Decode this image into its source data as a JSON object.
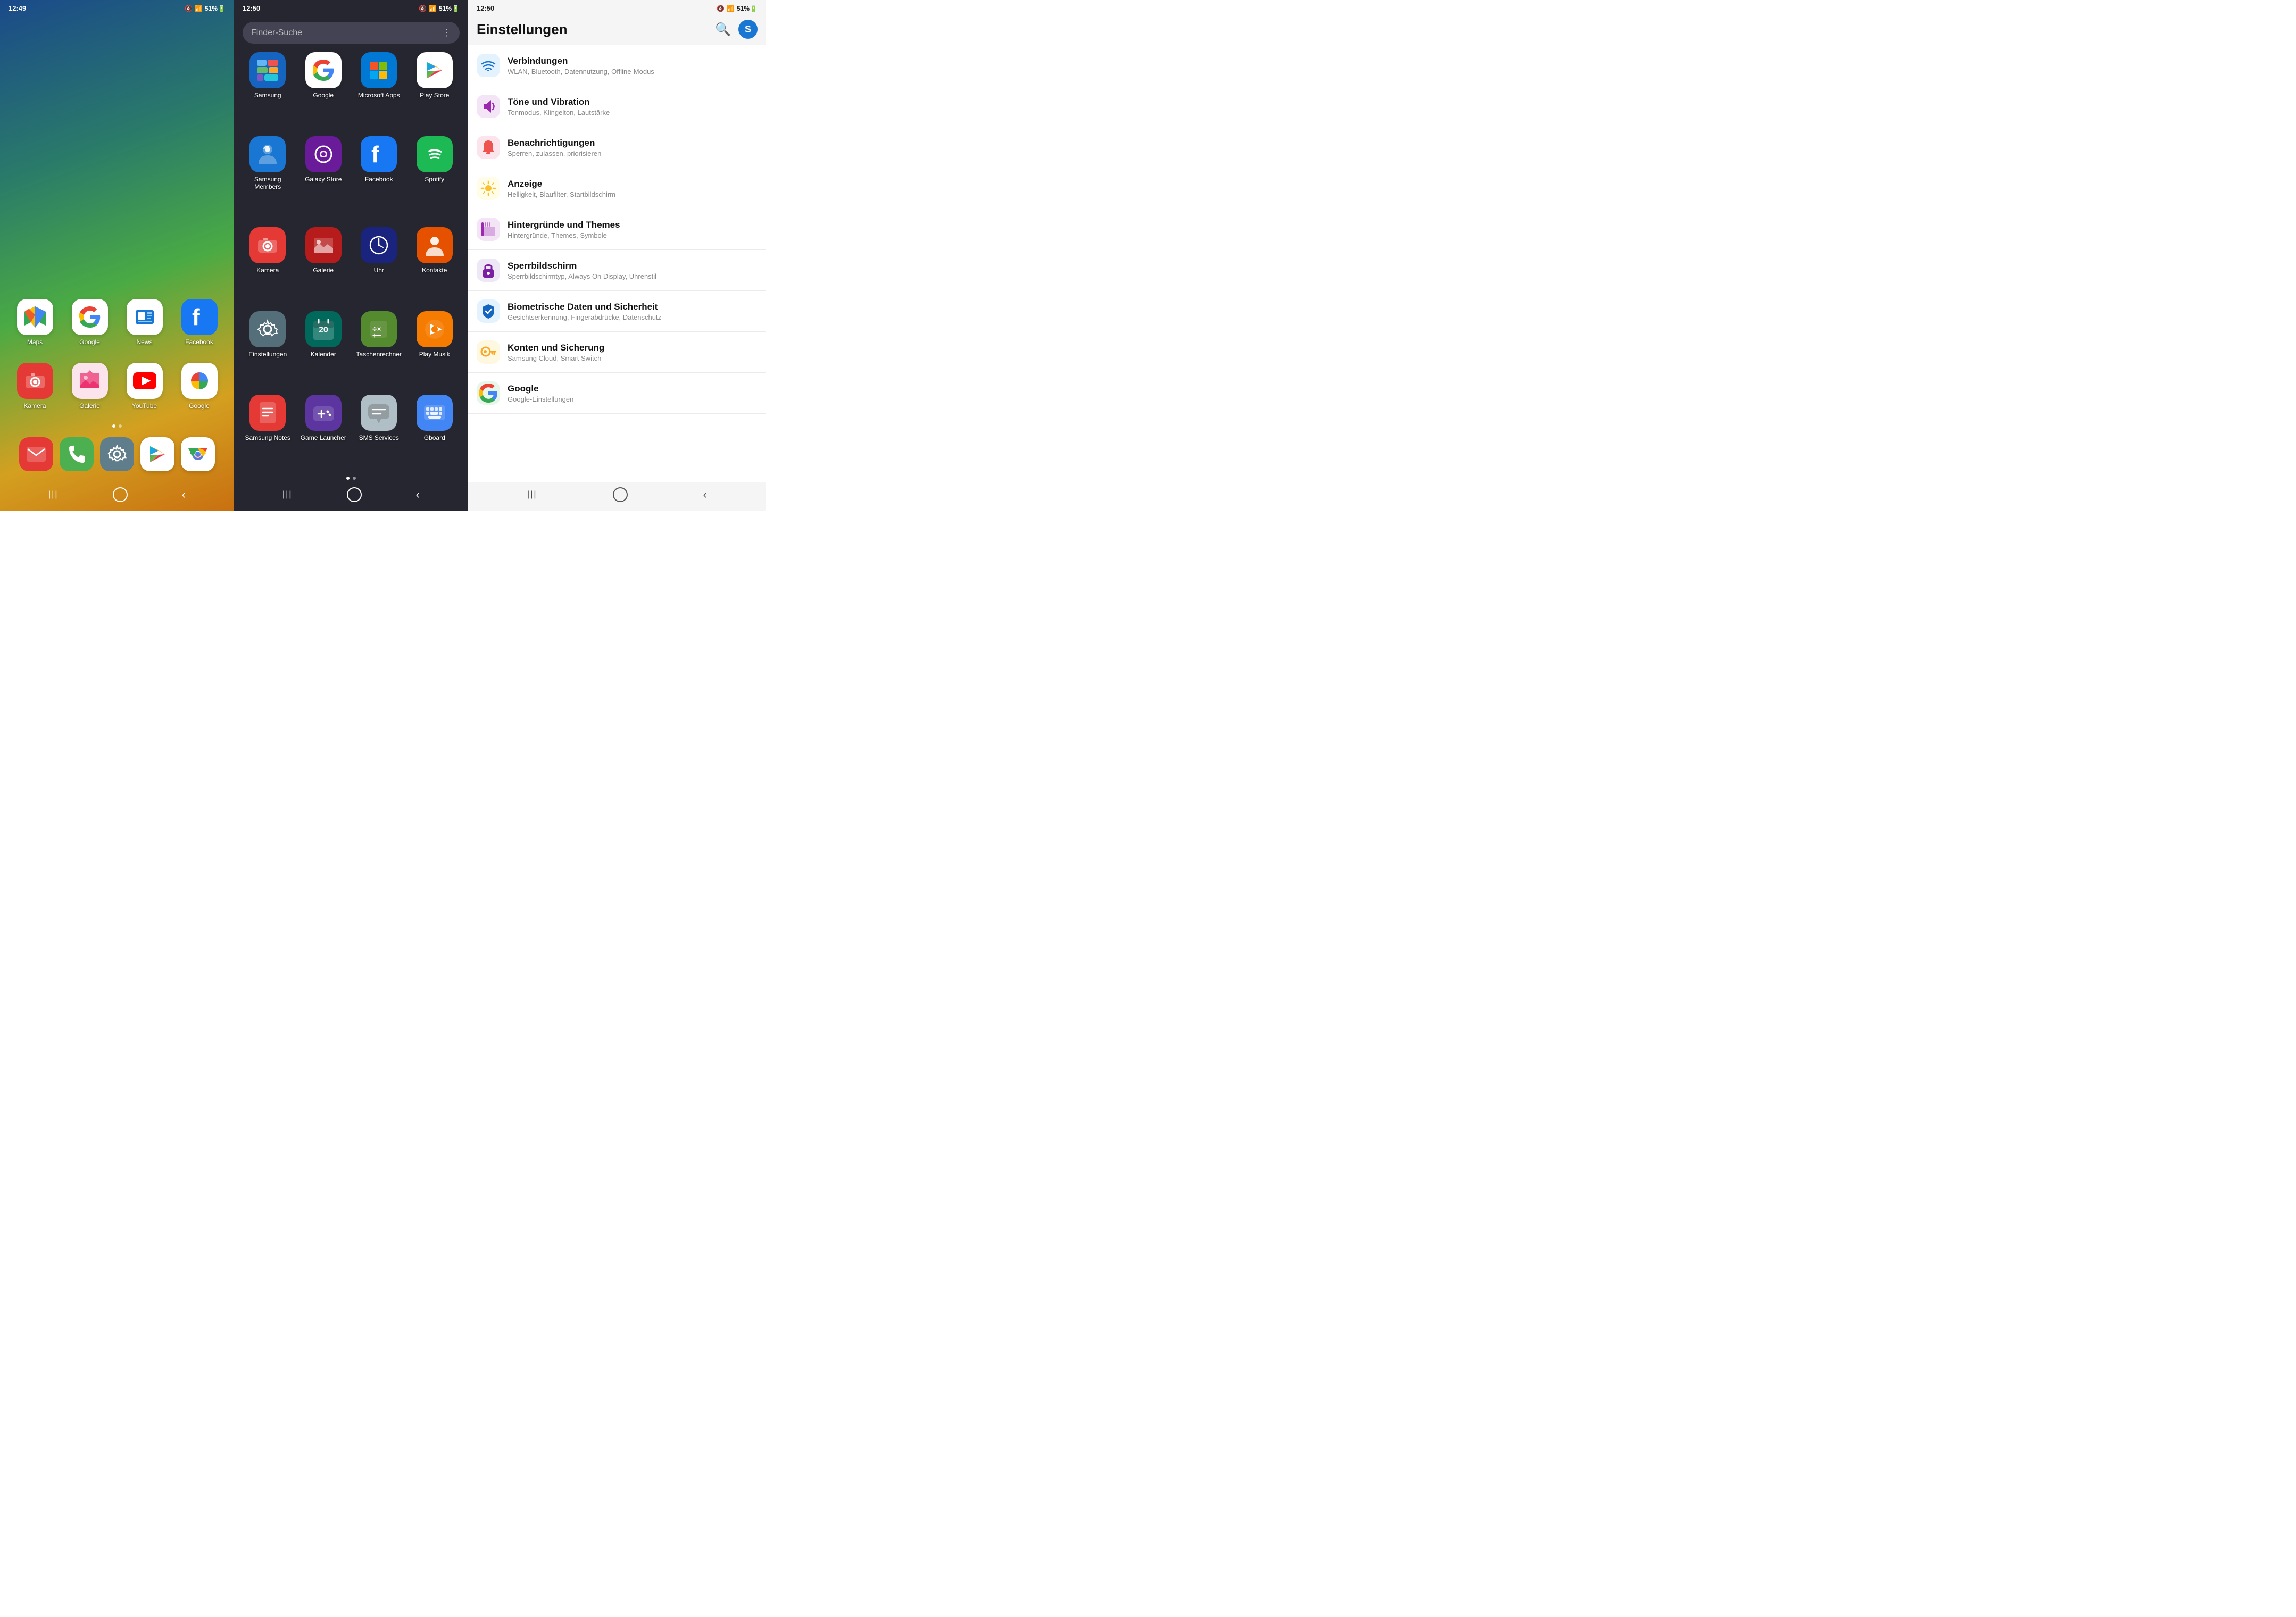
{
  "panel1": {
    "time": "12:49",
    "status_icons": "🔇 📶 51%🔋",
    "icons_row1": [
      {
        "label": "Maps",
        "bg": "white",
        "icon": "maps"
      },
      {
        "label": "Google",
        "bg": "white",
        "icon": "google"
      },
      {
        "label": "News",
        "bg": "white",
        "icon": "news"
      },
      {
        "label": "Facebook",
        "bg": "#1877F2",
        "icon": "facebook"
      }
    ],
    "icons_row2": [
      {
        "label": "Kamera",
        "bg": "#e53935",
        "icon": "camera"
      },
      {
        "label": "Galerie",
        "bg": "#f8f8f8",
        "icon": "galerie"
      },
      {
        "label": "YouTube",
        "bg": "#ff0000",
        "icon": "youtube"
      },
      {
        "label": "Google",
        "bg": "#f8f8f8",
        "icon": "googledots"
      }
    ],
    "dock": [
      {
        "label": "Mail",
        "bg": "#e53935",
        "icon": "mail"
      },
      {
        "label": "Phone",
        "bg": "#4caf50",
        "icon": "phone"
      },
      {
        "label": "Settings",
        "bg": "#607d8b",
        "icon": "settings"
      },
      {
        "label": "PlayStore",
        "bg": "white",
        "icon": "playstore"
      },
      {
        "label": "Chrome",
        "bg": "white",
        "icon": "chrome"
      }
    ],
    "nav": [
      "|||",
      "○",
      "‹"
    ]
  },
  "panel2": {
    "time": "12:50",
    "search_placeholder": "Finder-Suche",
    "apps": [
      {
        "label": "Samsung",
        "bg": "#1565c0",
        "icon": "samsung"
      },
      {
        "label": "Google",
        "bg": "white",
        "icon": "google"
      },
      {
        "label": "Microsoft Apps",
        "bg": "#0078d4",
        "icon": "microsoft"
      },
      {
        "label": "Play Store",
        "bg": "white",
        "icon": "playstore"
      },
      {
        "label": "Samsung Members",
        "bg": "#1976d2",
        "icon": "samsungmembers"
      },
      {
        "label": "Galaxy Store",
        "bg": "#6a1b9a",
        "icon": "galaxystore"
      },
      {
        "label": "Facebook",
        "bg": "#1877F2",
        "icon": "facebook"
      },
      {
        "label": "Spotify",
        "bg": "#1db954",
        "icon": "spotify"
      },
      {
        "label": "Kamera",
        "bg": "#e53935",
        "icon": "camera"
      },
      {
        "label": "Galerie",
        "bg": "#b71c1c",
        "icon": "galerie2"
      },
      {
        "label": "Uhr",
        "bg": "#1a237e",
        "icon": "clock"
      },
      {
        "label": "Kontakte",
        "bg": "#e65100",
        "icon": "contacts"
      },
      {
        "label": "Einstellungen",
        "bg": "#546e7a",
        "icon": "settings"
      },
      {
        "label": "Kalender",
        "bg": "#00695c",
        "icon": "calendar"
      },
      {
        "label": "Taschenrechner",
        "bg": "#558b2f",
        "icon": "calculator"
      },
      {
        "label": "Play Musik",
        "bg": "#f57c00",
        "icon": "playmusic"
      },
      {
        "label": "Samsung Notes",
        "bg": "#e53935",
        "icon": "notes"
      },
      {
        "label": "Game Launcher",
        "bg": "#5c35a0",
        "icon": "gamelauncher"
      },
      {
        "label": "SMS Services",
        "bg": "#b0bec5",
        "icon": "sms"
      },
      {
        "label": "Gboard",
        "bg": "#4285f4",
        "icon": "gboard"
      }
    ],
    "nav": [
      "|||",
      "○",
      "‹"
    ]
  },
  "panel3": {
    "time": "12:50",
    "title": "Einstellungen",
    "settings": [
      {
        "icon": "wifi",
        "icon_color": "#1976d2",
        "bg_color": "#e3f2fd",
        "label": "Verbindungen",
        "sub": "WLAN, Bluetooth, Datennutzung, Offline-Modus"
      },
      {
        "icon": "volume",
        "icon_color": "#9c27b0",
        "bg_color": "#f3e5f5",
        "label": "Töne und Vibration",
        "sub": "Tonmodus, Klingelton, Lautstärke"
      },
      {
        "icon": "bell",
        "icon_color": "#ef5350",
        "bg_color": "#fce4ec",
        "label": "Benachrichtigungen",
        "sub": "Sperren, zulassen, priorisieren"
      },
      {
        "icon": "brightness",
        "icon_color": "#fbc02d",
        "bg_color": "#fffde7",
        "label": "Anzeige",
        "sub": "Helligkeit, Blaufilter, Startbildschirm"
      },
      {
        "icon": "themes",
        "icon_color": "#9c27b0",
        "bg_color": "#f3e5f5",
        "label": "Hintergründe und Themes",
        "sub": "Hintergründe, Themes, Symbole"
      },
      {
        "icon": "lock",
        "icon_color": "#7b1fa2",
        "bg_color": "#ede7f6",
        "label": "Sperrbildschirm",
        "sub": "Sperrbildschirmtyp, Always On Display, Uhrenstil"
      },
      {
        "icon": "shield",
        "icon_color": "#1565c0",
        "bg_color": "#e3f2fd",
        "label": "Biometrische Daten und Sicherheit",
        "sub": "Gesichtserkennung, Fingerabdrücke, Datenschutz"
      },
      {
        "icon": "key",
        "icon_color": "#f9a825",
        "bg_color": "#fff8e1",
        "label": "Konten und Sicherung",
        "sub": "Samsung Cloud, Smart Switch"
      },
      {
        "icon": "google",
        "icon_color": "#4285f4",
        "bg_color": "#e8f5e9",
        "label": "Google",
        "sub": "Google-Einstellungen"
      }
    ],
    "nav": [
      "|||",
      "○",
      "‹"
    ]
  }
}
